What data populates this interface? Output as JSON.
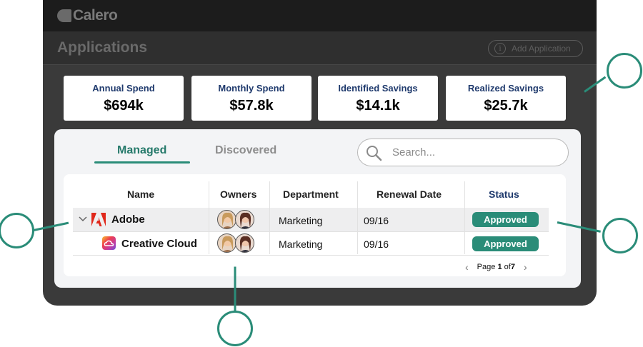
{
  "app": {
    "logo_text": "Calero"
  },
  "header": {
    "title": "Applications",
    "add_button_label": "Add Application",
    "add_icon_glyph": "i"
  },
  "kpis": [
    {
      "label": "Annual Spend",
      "value": "$694k"
    },
    {
      "label": "Monthly Spend",
      "value": "$57.8k"
    },
    {
      "label": "Identified Savings",
      "value": "$14.1k"
    },
    {
      "label": "Realized Savings",
      "value": "$25.7k"
    }
  ],
  "tabs": {
    "managed": "Managed",
    "discovered": "Discovered",
    "active": "Managed"
  },
  "search": {
    "placeholder": "Search..."
  },
  "table": {
    "columns": [
      "Name",
      "Owners",
      "Department",
      "Renewal Date",
      "Status"
    ],
    "rows": [
      {
        "name": "Adobe",
        "icon": "adobe-logo-icon",
        "owners": [
          "owner-avatar-1",
          "owner-avatar-2"
        ],
        "department": "Marketing",
        "renewal": "09/16",
        "status": "Approved",
        "expanded": true
      },
      {
        "name": "Creative Cloud",
        "icon": "creative-cloud-icon",
        "owners": [
          "owner-avatar-1",
          "owner-avatar-2"
        ],
        "department": "Marketing",
        "renewal": "09/16",
        "status": "Approved"
      }
    ]
  },
  "pagination": {
    "prefix": "Page",
    "current": "1",
    "separator": "of",
    "total": "7"
  },
  "colors": {
    "accent": "#2a8c78",
    "kpi_label": "#1f3a6d",
    "frame": "#3a3a3a"
  }
}
